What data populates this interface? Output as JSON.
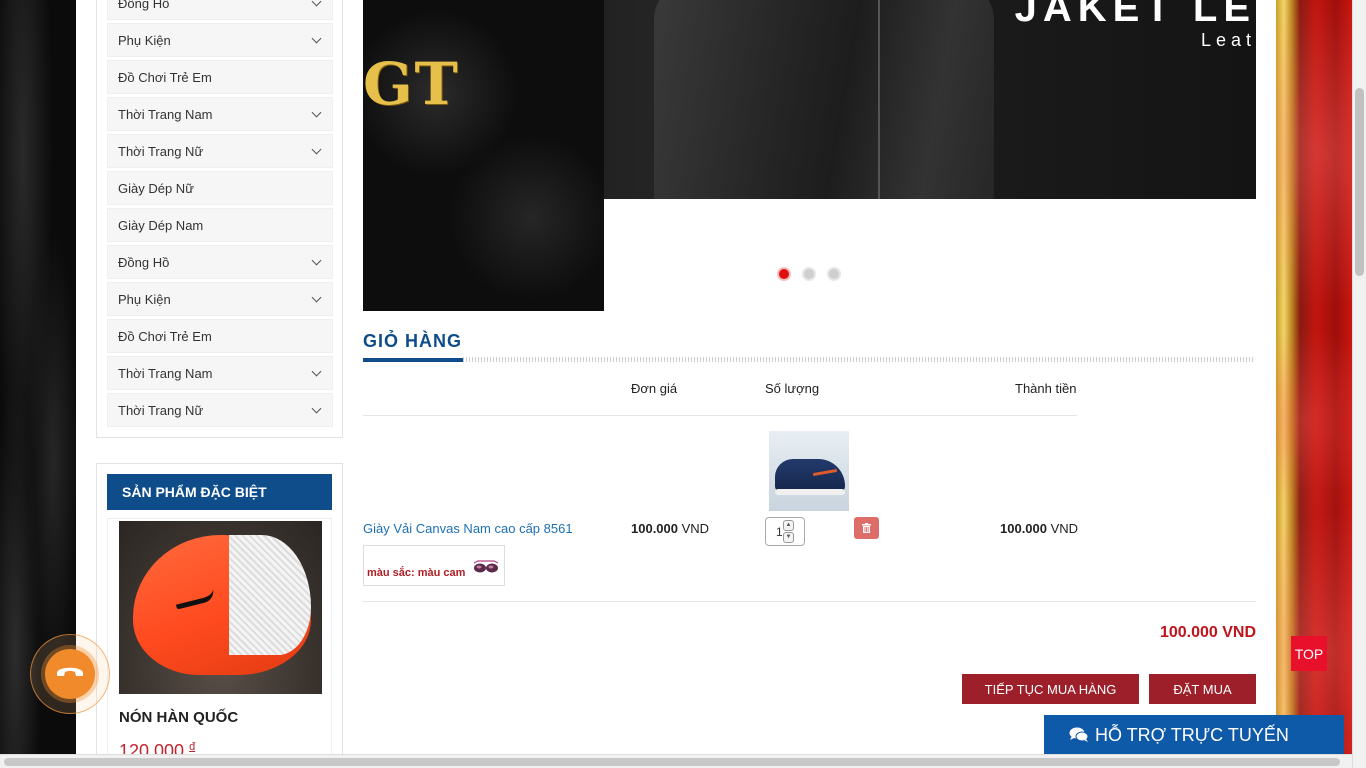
{
  "sidebar": {
    "categories": [
      {
        "label": "Đồng Hồ",
        "has_children": true
      },
      {
        "label": "Phụ Kiện",
        "has_children": true
      },
      {
        "label": "Đồ Chơi Trẻ Em",
        "has_children": false
      },
      {
        "label": "Thời Trang Nam",
        "has_children": true
      },
      {
        "label": "Thời Trang Nữ",
        "has_children": true
      },
      {
        "label": "Giày Dép Nữ",
        "has_children": false
      },
      {
        "label": "Giày Dép Nam",
        "has_children": false
      },
      {
        "label": "Đồng Hồ",
        "has_children": true
      },
      {
        "label": "Phụ Kiện",
        "has_children": true
      },
      {
        "label": "Đồ Chơi Trẻ Em",
        "has_children": false
      },
      {
        "label": "Thời Trang Nam",
        "has_children": true
      },
      {
        "label": "Thời Trang Nữ",
        "has_children": true
      }
    ],
    "special": {
      "title": "SẢN PHẨM ĐẶC BIỆT",
      "product_name": "NÓN HÀN QUỐC",
      "price": "120.000",
      "currency": "đ"
    }
  },
  "banner": {
    "left_text": "GT",
    "headline": "JAKET LE",
    "subline": "Leat",
    "dots": [
      true,
      false,
      false
    ]
  },
  "cart": {
    "title": "GIỎ HÀNG",
    "headers": {
      "unit_price": "Đơn giá",
      "quantity": "Số lượng",
      "subtotal": "Thành tiền"
    },
    "item": {
      "name": "Giày Vải Canvas Nam cao cấp 8561",
      "variant": "màu sắc: màu cam",
      "unit_price": "100.000",
      "unit_currency": "VND",
      "quantity": "1",
      "subtotal": "100.000",
      "subtotal_currency": "VND"
    },
    "grand_total": "100.000 VND",
    "continue_label": "TIẾP TỤC MUA HÀNG",
    "order_label": "ĐẶT MUA"
  },
  "widgets": {
    "top_label": "TOP",
    "support_label": "HỖ TRỢ TRỰC TUYẾN"
  },
  "colors": {
    "primary_blue": "#0f4c8a",
    "button_red": "#9c1f2a",
    "total_red": "#c0141b",
    "support_blue": "#0f5aa8"
  }
}
